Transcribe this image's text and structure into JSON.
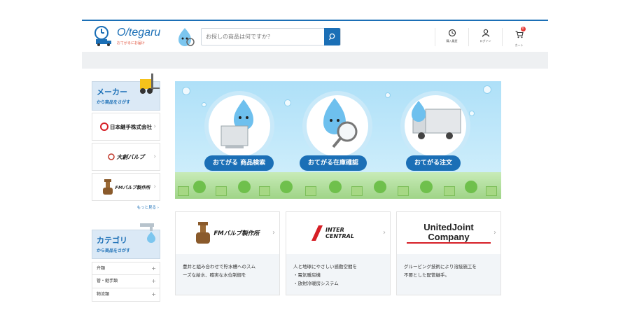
{
  "header": {
    "logo_text": "O/tegaru",
    "logo_sub": "おてがるにお届け",
    "search_placeholder": "お探しの商品は何ですか？",
    "nav": [
      {
        "label": "購入履歴",
        "icon": "history-icon"
      },
      {
        "label": "ログイン",
        "icon": "user-icon"
      },
      {
        "label": "カート",
        "icon": "cart-icon",
        "badge": "0"
      }
    ]
  },
  "sidebar": {
    "maker_title": "メーカー",
    "maker_sub": "から商品をさがす",
    "makers": [
      "日本継手株式会社",
      "大創バルブ",
      "FMバルブ製作所"
    ],
    "more": "もっと見る",
    "category_title": "カテゴリ",
    "category_sub": "から商品をさがす",
    "categories": [
      "弁類",
      "管・継手類",
      "物流類"
    ]
  },
  "hero": {
    "buttons": [
      "おてがる 商品検索",
      "おてがる在庫確認",
      "おてがる注文"
    ]
  },
  "brands": [
    {
      "name": "FMバルブ製作所",
      "desc": "豊井と組み合わせで貯水槽へのスム\nーズな給水、確実な水位制御を"
    },
    {
      "name": "INTER CENTRAL",
      "desc": "人と地球にやさしい感動空間を\n・電気暖房機\n・放射冷暖房システム"
    },
    {
      "name": "UnitedJoint Company",
      "desc": "グルービング技術により溶接施工を\n不要とした配管継手。"
    }
  ],
  "colors": {
    "accent": "#1b6fb6",
    "badge": "#e53935"
  }
}
